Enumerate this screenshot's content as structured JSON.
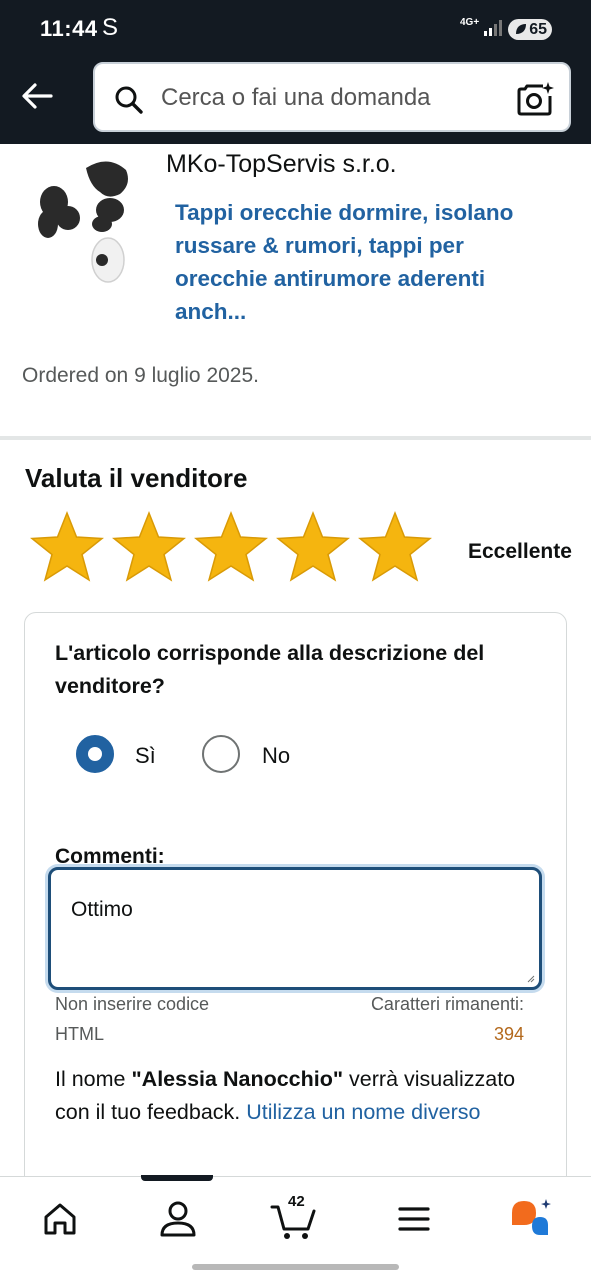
{
  "status_bar": {
    "time": "11:44",
    "carrier_glyph": "S",
    "network": "4G+",
    "battery": "65"
  },
  "header": {
    "search_placeholder": "Cerca o fai una domanda"
  },
  "product": {
    "seller": "MKo-TopServis s.r.o.",
    "title": "Tappi orecchie dormire, isolano russare & rumori, tappi per orecchie antirumore aderenti anch...",
    "ordered": "Ordered on 9 luglio 2025."
  },
  "rating": {
    "title": "Valuta il venditore",
    "stars_filled": 5,
    "stars_total": 5,
    "label": "Eccellente",
    "star_color": "#f5b50f"
  },
  "feedback": {
    "question": "L'articolo corrisponde alla descrizione del venditore?",
    "options": [
      {
        "label": "Sì",
        "selected": true
      },
      {
        "label": "No",
        "selected": false
      }
    ],
    "comments_label": "Commenti:",
    "comment_value": "Ottimo",
    "hint": "Non inserire codice HTML",
    "remaining_label": "Caratteri rimanenti:",
    "remaining_count": "394",
    "name_note_prefix": "Il nome ",
    "name_note_name": "\"Alessia Nanocchio\"",
    "name_note_suffix": " verrà visualizzato con il tuo feedback. ",
    "name_note_link": "Utilizza un nome diverso"
  },
  "bottom_nav": {
    "items": [
      "home-icon",
      "account-icon",
      "cart-icon",
      "menu-icon",
      "rufus-icon"
    ],
    "cart_count": "42"
  }
}
